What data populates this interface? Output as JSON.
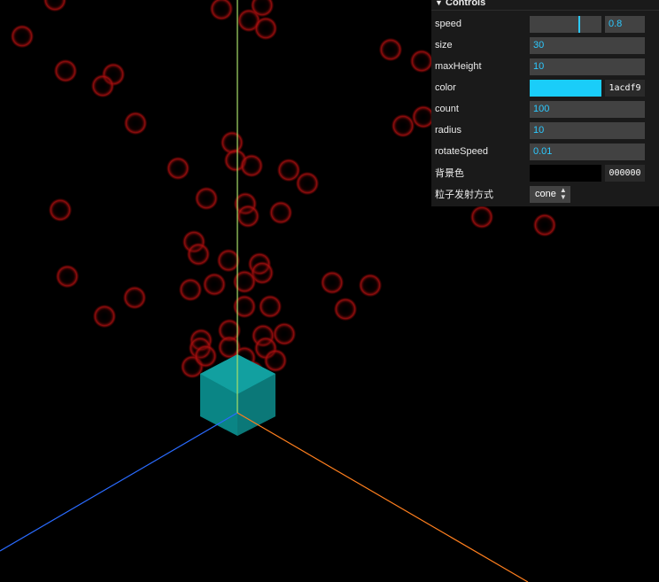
{
  "panel": {
    "title": "Controls",
    "rows": {
      "speed": {
        "label": "speed",
        "value": "0.8",
        "fraction": 0.7
      },
      "size": {
        "label": "size",
        "value": "30"
      },
      "maxHeight": {
        "label": "maxHeight",
        "value": "10"
      },
      "color": {
        "label": "color",
        "hex": "1acdf9",
        "swatch": "#1acdf9"
      },
      "count": {
        "label": "count",
        "value": "100"
      },
      "radius": {
        "label": "radius",
        "value": "10"
      },
      "rotateSpeed": {
        "label": "rotateSpeed",
        "value": "0.01"
      },
      "bgColor": {
        "label": "背景色",
        "hex": "000000",
        "swatch": "#000000"
      },
      "emitMode": {
        "label": "粒子发射方式",
        "value": "cone"
      }
    }
  },
  "scene": {
    "background": "#000000",
    "axis_colors": {
      "x": "#ff7f1e",
      "y": "#a8e06a",
      "z": "#2a6bff"
    },
    "cube_color": "#0e8a8a",
    "particle_color": "#cc1111"
  }
}
